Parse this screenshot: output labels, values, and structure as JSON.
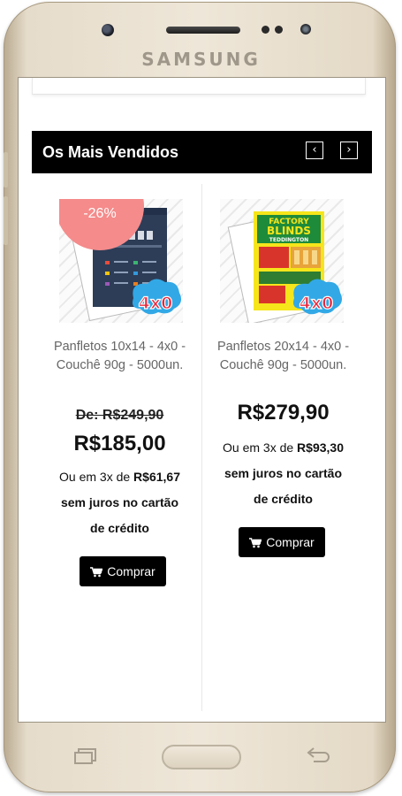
{
  "device": {
    "brand": "SAMSUNG"
  },
  "section": {
    "title": "Os Mais Vendidos"
  },
  "products": [
    {
      "badge": "-26%",
      "name_line1": "Panfletos 10x14 - 4x0 -",
      "name_line2": "Couchê 90g - 5000un.",
      "old_price": "De: R$249,90",
      "price": "R$185,00",
      "inst_prefix": "Ou em 3x de ",
      "inst_value": "R$61,67",
      "inst_line2": "sem juros no cartão",
      "inst_line3": "de crédito",
      "buy_label": "Comprar",
      "image_tag": "4x0"
    },
    {
      "name_line1": "Panfletos 20x14 - 4x0 -",
      "name_line2": "Couchê 90g - 5000un.",
      "price": "R$279,90",
      "inst_prefix": "Ou em 3x de ",
      "inst_value": "R$93,30",
      "inst_line2": "sem juros no cartão",
      "inst_line3": "de crédito",
      "buy_label": "Comprar",
      "image_tag": "4x0",
      "flyer_title1": "FACTORY",
      "flyer_title2": "BLINDS",
      "flyer_title3": "TEDDINGTON"
    }
  ],
  "colors": {
    "badge": "#f58b8b",
    "header": "#000000",
    "button": "#000000"
  },
  "icons": [
    "camera-icon",
    "chevron-left-icon",
    "chevron-right-icon",
    "cart-icon",
    "recent-apps-icon",
    "home-button",
    "back-icon"
  ]
}
